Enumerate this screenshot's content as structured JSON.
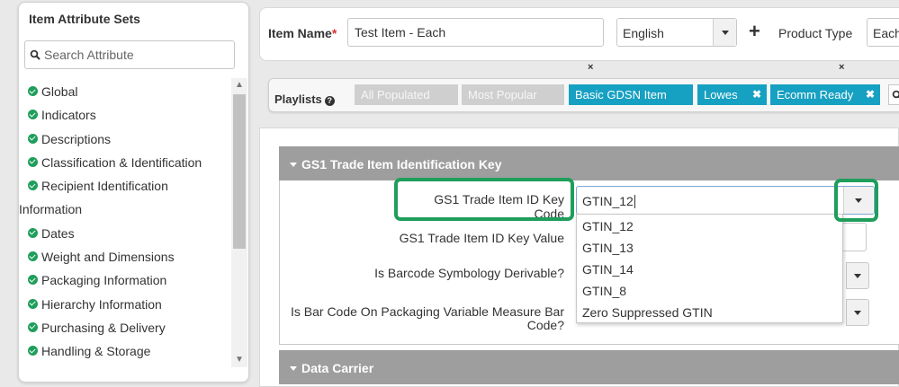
{
  "sidebar": {
    "title": "Item Attribute Sets",
    "search_placeholder": "Search Attribute",
    "items": [
      {
        "label": "Global",
        "check": true
      },
      {
        "label": "Indicators",
        "check": true
      },
      {
        "label": "Descriptions",
        "check": true
      },
      {
        "label": "Classification & Identification",
        "check": true
      },
      {
        "label": "Recipient Identification",
        "check": true
      },
      {
        "label": "Information",
        "check": false
      },
      {
        "label": "Dates",
        "check": true
      },
      {
        "label": "Weight and Dimensions",
        "check": true
      },
      {
        "label": "Packaging Information",
        "check": true
      },
      {
        "label": "Hierarchy Information",
        "check": true
      },
      {
        "label": "Purchasing & Delivery",
        "check": true
      },
      {
        "label": "Handling & Storage",
        "check": true
      }
    ]
  },
  "header": {
    "item_name_label": "Item Name",
    "required_mark": "*",
    "item_name_value": "Test Item - Each",
    "language_value": "English",
    "product_type_label": "Product Type",
    "product_type_value": "Each",
    "remove_mark": "×"
  },
  "playlists": {
    "label": "Playlists",
    "help_glyph": "?",
    "chips": [
      {
        "label": "All Populated",
        "state": "inactive"
      },
      {
        "label": "Most Popular",
        "state": "inactive"
      },
      {
        "label": "Basic GDSN Item",
        "state": "active"
      },
      {
        "label": "Lowes",
        "state": "active",
        "removable": true
      },
      {
        "label": "Ecomm Ready",
        "state": "active",
        "removable": true
      }
    ],
    "remove_glyph": "✖"
  },
  "section_identification": {
    "title": "GS1 Trade Item Identification Key",
    "key_code_label": "GS1 Trade Item ID Key Code",
    "key_code_value": "GTIN_12",
    "key_value_label": "GS1 Trade Item ID Key Value",
    "barcode_derivable_label": "Is Barcode Symbology Derivable?",
    "variable_measure_label_line1": "Is Bar Code On Packaging Variable Measure Bar",
    "variable_measure_label_line2": "Code?",
    "options": [
      "GTIN_12",
      "GTIN_13",
      "GTIN_14",
      "GTIN_8",
      "Zero Suppressed GTIN"
    ]
  },
  "section_data_carrier": {
    "title": "Data Carrier"
  },
  "colors": {
    "accent_green": "#1f9e5b",
    "chip_active": "#16a0c2",
    "chip_inactive": "#cfcfcf",
    "section_header": "#9e9e9e",
    "required": "#d9302c"
  }
}
